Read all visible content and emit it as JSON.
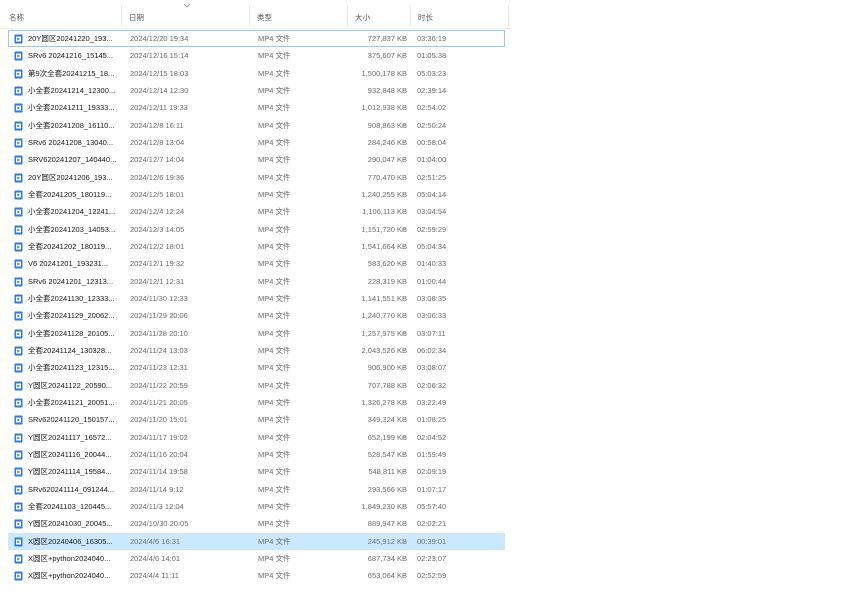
{
  "columns": {
    "name": "名称",
    "date": "日期",
    "type": "类型",
    "size": "大小",
    "duration": "时长"
  },
  "colors": {
    "selected_bg": "#cce8ff",
    "focus_border": "#99c9f2",
    "icon_blue": "#2f7ad6"
  },
  "files": [
    {
      "name": "20Y圆区20241220_193...",
      "date": "2024/12/20 19:34",
      "type": "MP4 文件",
      "size": "727,837 KB",
      "duration": "03:36:19",
      "state": "focused"
    },
    {
      "name": "SRv6 20241216_15145...",
      "date": "2024/12/16 15:14",
      "type": "MP4 文件",
      "size": "375,607 KB",
      "duration": "01:05:38",
      "state": ""
    },
    {
      "name": "第9次全套20241215_18...",
      "date": "2024/12/15 18:03",
      "type": "MP4 文件",
      "size": "1,500,178 KB",
      "duration": "05:03:23",
      "state": ""
    },
    {
      "name": "小全套20241214_12300...",
      "date": "2024/12/14 12:30",
      "type": "MP4 文件",
      "size": "932,848 KB",
      "duration": "02:39:14",
      "state": ""
    },
    {
      "name": "小全套20241211_19333...",
      "date": "2024/12/11 19:33",
      "type": "MP4 文件",
      "size": "1,012,938 KB",
      "duration": "02:54:02",
      "state": ""
    },
    {
      "name": "小全套20241208_16110...",
      "date": "2024/12/8 16:11",
      "type": "MP4 文件",
      "size": "908,863 KB",
      "duration": "02:50:24",
      "state": ""
    },
    {
      "name": "SRv6 20241208_13040...",
      "date": "2024/12/8 13:04",
      "type": "MP4 文件",
      "size": "284,246 KB",
      "duration": "00:58:04",
      "state": ""
    },
    {
      "name": "SRV620241207_140440...",
      "date": "2024/12/7 14:04",
      "type": "MP4 文件",
      "size": "290,047 KB",
      "duration": "01:04:00",
      "state": ""
    },
    {
      "name": "20Y圆区20241206_193...",
      "date": "2024/12/6 19:36",
      "type": "MP4 文件",
      "size": "770,470 KB",
      "duration": "02:51:25",
      "state": ""
    },
    {
      "name": "全套20241205_180119...",
      "date": "2024/12/5 18:01",
      "type": "MP4 文件",
      "size": "1,240,255 KB",
      "duration": "05:04:14",
      "state": ""
    },
    {
      "name": "小全套20241204_12241...",
      "date": "2024/12/4 12:24",
      "type": "MP4 文件",
      "size": "1,106,113 KB",
      "duration": "03:04:54",
      "state": ""
    },
    {
      "name": "小全套20241203_14053...",
      "date": "2024/12/3 14:05",
      "type": "MP4 文件",
      "size": "1,151,720 KB",
      "duration": "02:59:29",
      "state": ""
    },
    {
      "name": "全套20241202_180119...",
      "date": "2024/12/2 18:01",
      "type": "MP4 文件",
      "size": "1,541,664 KB",
      "duration": "05:04:34",
      "state": ""
    },
    {
      "name": "V6 20241201_193231...",
      "date": "2024/12/1 19:32",
      "type": "MP4 文件",
      "size": "583,620 KB",
      "duration": "01:40:33",
      "state": ""
    },
    {
      "name": "SRv6 20241201_12313...",
      "date": "2024/12/1 12:31",
      "type": "MP4 文件",
      "size": "228,319 KB",
      "duration": "01:00:44",
      "state": ""
    },
    {
      "name": "小全套20241130_12333...",
      "date": "2024/11/30 12:33",
      "type": "MP4 文件",
      "size": "1,141,551 KB",
      "duration": "03:08:35",
      "state": ""
    },
    {
      "name": "小全套20241129_20062...",
      "date": "2024/11/29 20:06",
      "type": "MP4 文件",
      "size": "1,240,770 KB",
      "duration": "03:06:33",
      "state": ""
    },
    {
      "name": "小全套20241128_20105...",
      "date": "2024/11/28 20:10",
      "type": "MP4 文件",
      "size": "1,257,975 KB",
      "duration": "03:07:11",
      "state": ""
    },
    {
      "name": "全套20241124_130328...",
      "date": "2024/11/24 13:03",
      "type": "MP4 文件",
      "size": "2,043,526 KB",
      "duration": "06:02:34",
      "state": ""
    },
    {
      "name": "小全套20241123_12315...",
      "date": "2024/11/23 12:31",
      "type": "MP4 文件",
      "size": "906,900 KB",
      "duration": "03:08:07",
      "state": ""
    },
    {
      "name": "Y圆区20241122_20590...",
      "date": "2024/11/22 20:59",
      "type": "MP4 文件",
      "size": "707,788 KB",
      "duration": "02:06:32",
      "state": ""
    },
    {
      "name": "小全套20241121_20051...",
      "date": "2024/11/21 20:05",
      "type": "MP4 文件",
      "size": "1,326,278 KB",
      "duration": "03:22:49",
      "state": ""
    },
    {
      "name": "SRv620241120_150157...",
      "date": "2024/11/20 15:01",
      "type": "MP4 文件",
      "size": "349,324 KB",
      "duration": "01:08:25",
      "state": ""
    },
    {
      "name": "Y圆区20241117_16572...",
      "date": "2024/11/17 19:02",
      "type": "MP4 文件",
      "size": "652,199 KB",
      "duration": "02:04:52",
      "state": ""
    },
    {
      "name": "Y圆区20241116_20044...",
      "date": "2024/11/16 20:04",
      "type": "MP4 文件",
      "size": "528,547 KB",
      "duration": "01:59:49",
      "state": ""
    },
    {
      "name": "Y圆区20241114_19584...",
      "date": "2024/11/14 19:58",
      "type": "MP4 文件",
      "size": "548,811 KB",
      "duration": "02:09:19",
      "state": ""
    },
    {
      "name": "SRv620241114_091244...",
      "date": "2024/11/14 9:12",
      "type": "MP4 文件",
      "size": "293,566 KB",
      "duration": "01:07:17",
      "state": ""
    },
    {
      "name": "全套20241103_120445...",
      "date": "2024/11/3 12:04",
      "type": "MP4 文件",
      "size": "1,849,230 KB",
      "duration": "05:57:40",
      "state": ""
    },
    {
      "name": "Y圆区20241030_20045...",
      "date": "2024/10/30 20:05",
      "type": "MP4 文件",
      "size": "889,947 KB",
      "duration": "02:02:21",
      "state": ""
    },
    {
      "name": "X圆区20240406_16305...",
      "date": "2024/4/6 16:31",
      "type": "MP4 文件",
      "size": "245,912 KB",
      "duration": "00:39:01",
      "state": "selected"
    },
    {
      "name": "X圆区+python2024040...",
      "date": "2024/4/6 14:01",
      "type": "MP4 文件",
      "size": "687,734 KB",
      "duration": "02:23:07",
      "state": ""
    },
    {
      "name": "X圆区+python2024040...",
      "date": "2024/4/4 11:11",
      "type": "MP4 文件",
      "size": "653,064 KB",
      "duration": "02:52:59",
      "state": ""
    }
  ]
}
